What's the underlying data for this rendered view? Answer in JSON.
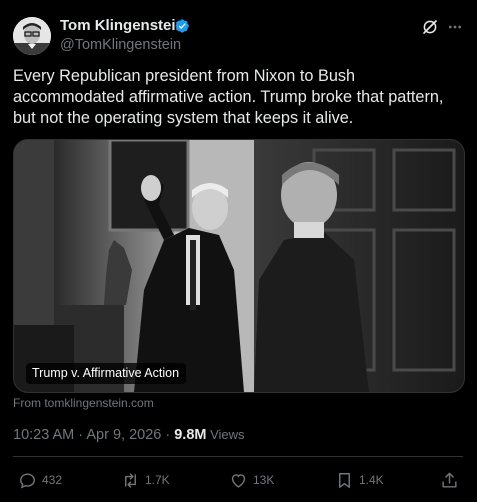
{
  "author": {
    "name": "Tom Klingenstein",
    "handle": "@TomKlingenstein",
    "verified": true,
    "verified_color": "#1d9bf0"
  },
  "header_icons": [
    "grok-icon",
    "more-icon"
  ],
  "tweet": {
    "text": "Every Republican president from Nixon to Bush accommodated affirmative action. Trump broke that pattern, but not the operating system that keeps it alive."
  },
  "media": {
    "caption": "Trump v. Affirmative Action",
    "source": "From tomklingenstein.com"
  },
  "meta": {
    "time": "10:23 AM",
    "separator1": " · ",
    "date": "Apr 9, 2026",
    "separator2": " · ",
    "views_count": "9.8M",
    "views_label": " Views"
  },
  "actions": {
    "replies": "432",
    "reposts": "1.7K",
    "likes": "13K",
    "bookmarks": "1.4K",
    "icons": [
      "reply-icon",
      "repost-icon",
      "like-icon",
      "bookmark-icon",
      "share-icon"
    ]
  },
  "colors": {
    "background": "#000000",
    "text_primary": "#e7e9ea",
    "text_secondary": "#71767b",
    "border": "#2f3336"
  }
}
